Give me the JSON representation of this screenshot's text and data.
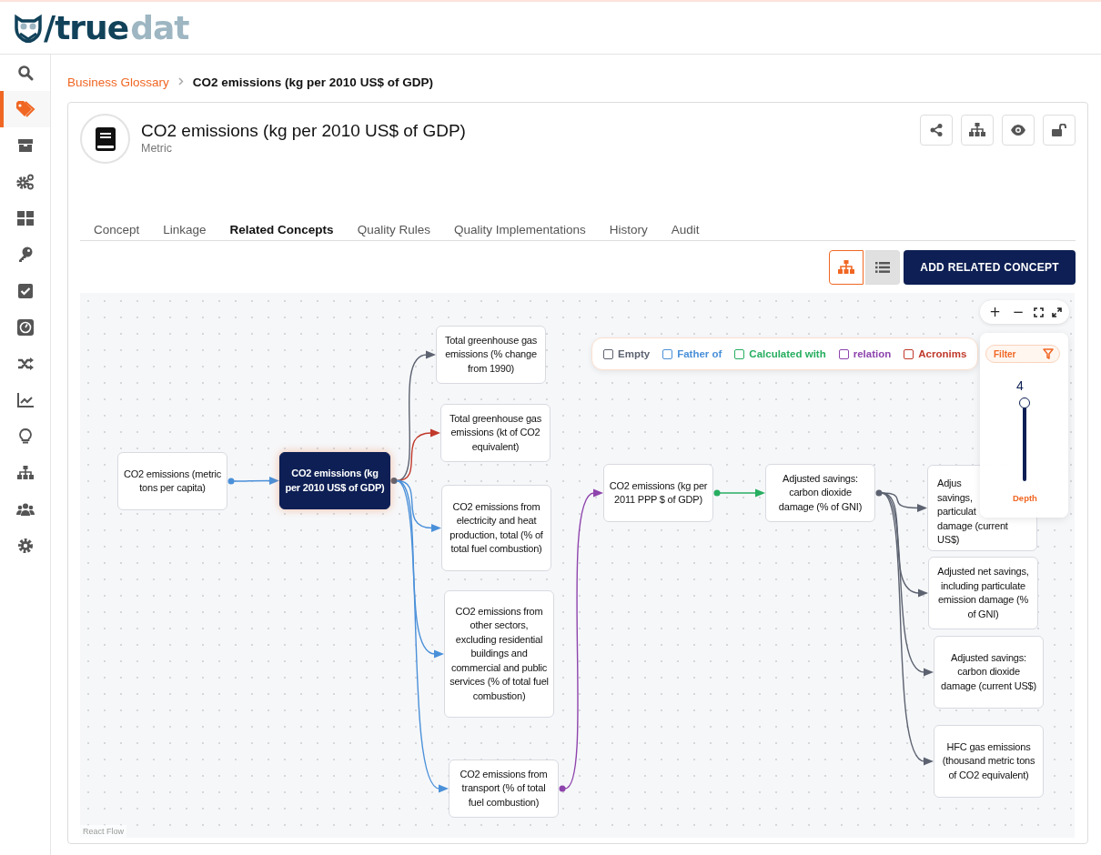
{
  "logo": {
    "text_dark": "/true",
    "text_light": "dat"
  },
  "sidebar": {
    "items": [
      {
        "kind": "search",
        "selected": false
      },
      {
        "kind": "tags",
        "selected": true
      },
      {
        "kind": "box",
        "selected": false
      },
      {
        "kind": "gears",
        "selected": false
      },
      {
        "kind": "grid",
        "selected": false
      },
      {
        "kind": "key",
        "selected": false
      },
      {
        "kind": "check",
        "selected": false
      },
      {
        "kind": "gauge",
        "selected": false
      },
      {
        "kind": "shuffle",
        "selected": false
      },
      {
        "kind": "chart",
        "selected": false
      },
      {
        "kind": "bulb",
        "selected": false
      },
      {
        "kind": "sitemap",
        "selected": false
      },
      {
        "kind": "users",
        "selected": false
      },
      {
        "kind": "cog",
        "selected": false
      }
    ]
  },
  "breadcrumb": [
    {
      "label": "Business Glossary",
      "kind": "link"
    },
    {
      "label": "CO2 emissions (kg per 2010 US$ of GDP)",
      "kind": "current"
    }
  ],
  "concept": {
    "title": "CO2 emissions (kg per 2010 US$ of GDP)",
    "type": "Metric",
    "actions": [
      {
        "kind": "share"
      },
      {
        "kind": "sitemap"
      },
      {
        "kind": "eye"
      },
      {
        "kind": "unlock"
      }
    ]
  },
  "tabs": [
    {
      "label": "Concept",
      "selected": false
    },
    {
      "label": "Linkage",
      "selected": false
    },
    {
      "label": "Related Concepts",
      "selected": true
    },
    {
      "label": "Quality Rules",
      "selected": false
    },
    {
      "label": "Quality Implementations",
      "selected": false
    },
    {
      "label": "History",
      "selected": false
    },
    {
      "label": "Audit",
      "selected": false
    }
  ],
  "view_toggle": [
    {
      "kind": "graph",
      "selected": true
    },
    {
      "kind": "list",
      "selected": false
    }
  ],
  "add_button": "ADD RELATED CONCEPT",
  "graph": {
    "legend": [
      {
        "label": "Empty",
        "color": "#5c6270",
        "checked": false
      },
      {
        "label": "Father of",
        "color": "#4a90d9",
        "checked": false
      },
      {
        "label": "Calculated with",
        "color": "#27ae60",
        "checked": false
      },
      {
        "label": "relation",
        "color": "#8e44ad",
        "checked": false
      },
      {
        "label": "Acronims",
        "color": "#c0392b",
        "checked": false
      }
    ],
    "zoom_controls": [
      "+",
      "−"
    ],
    "filter": {
      "label": "Filter",
      "depth_value": "4",
      "depth_label": "Depth"
    },
    "nodes": [
      {
        "text": "CO2 emissions (metric tons per capita)",
        "selected": false
      },
      {
        "text": "CO2 emissions (kg per 2010 US$ of GDP)",
        "selected": true
      },
      {
        "text": "Total greenhouse gas emissions (% change from 1990)",
        "selected": false
      },
      {
        "text": "Total greenhouse gas emissions (kt of CO2 equivalent)",
        "selected": false
      },
      {
        "text": "CO2 emissions from electricity and heat production, total (% of total fuel combustion)",
        "selected": false
      },
      {
        "text": "CO2 emissions from other sectors, excluding residential buildings and commercial and public services (% of total fuel combustion)",
        "selected": false
      },
      {
        "text": "CO2 emissions from transport (% of total fuel combustion)",
        "selected": false
      },
      {
        "text": "CO2 emissions (kg per 2011 PPP $ of GDP)",
        "selected": false
      },
      {
        "text": "Adjusted savings: carbon dioxide damage (% of GNI)",
        "selected": false
      },
      {
        "lines": [
          "Adjus",
          "savings,",
          "particulat",
          "damage (current",
          "US$)"
        ],
        "selected": false
      },
      {
        "text": "Adjusted net savings, including particulate emission damage (% of GNI)",
        "selected": false
      },
      {
        "text": "Adjusted savings: carbon dioxide damage (current US$)",
        "selected": false
      },
      {
        "text": "HFC gas emissions (thousand metric tons of CO2 equivalent)",
        "selected": false
      }
    ],
    "attribution": "React Flow"
  }
}
